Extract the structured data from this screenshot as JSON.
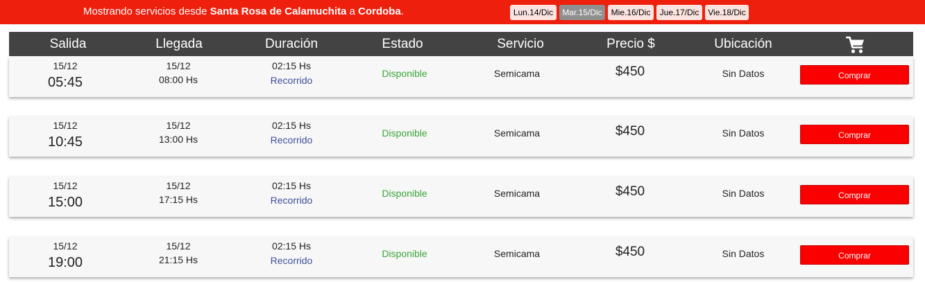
{
  "header": {
    "prefix": "Mostrando servicios desde",
    "origin": "Santa Rosa de Calamuchita",
    "connector": "a",
    "destination": "Cordoba",
    "suffix": ".",
    "days": [
      {
        "label": "Lun.14/Dic",
        "active": false
      },
      {
        "label": "Mar.15/Dic",
        "active": true
      },
      {
        "label": "Mie.16/Dic",
        "active": false
      },
      {
        "label": "Jue.17/Dic",
        "active": false
      },
      {
        "label": "Vie.18/Dic",
        "active": false
      }
    ]
  },
  "table": {
    "columns": [
      "Salida",
      "Llegada",
      "Duración",
      "Estado",
      "Servicio",
      "Precio $",
      "Ubicación"
    ],
    "cart_icon": "shopping-cart-icon",
    "rows": [
      {
        "salida_date": "15/12",
        "salida_time": "05:45",
        "llegada_date": "15/12",
        "llegada_time": "08:00 Hs",
        "duracion": "02:15 Hs",
        "recorrido": "Recorrido",
        "estado": "Disponible",
        "servicio": "Semicama",
        "precio": "$450",
        "ubicacion": "Sin Datos",
        "buy": "Comprar"
      },
      {
        "salida_date": "15/12",
        "salida_time": "10:45",
        "llegada_date": "15/12",
        "llegada_time": "13:00 Hs",
        "duracion": "02:15 Hs",
        "recorrido": "Recorrido",
        "estado": "Disponible",
        "servicio": "Semicama",
        "precio": "$450",
        "ubicacion": "Sin Datos",
        "buy": "Comprar"
      },
      {
        "salida_date": "15/12",
        "salida_time": "15:00",
        "llegada_date": "15/12",
        "llegada_time": "17:15 Hs",
        "duracion": "02:15 Hs",
        "recorrido": "Recorrido",
        "estado": "Disponible",
        "servicio": "Semicama",
        "precio": "$450",
        "ubicacion": "Sin Datos",
        "buy": "Comprar"
      },
      {
        "salida_date": "15/12",
        "salida_time": "19:00",
        "llegada_date": "15/12",
        "llegada_time": "21:15 Hs",
        "duracion": "02:15 Hs",
        "recorrido": "Recorrido",
        "estado": "Disponible",
        "servicio": "Semicama",
        "precio": "$450",
        "ubicacion": "Sin Datos",
        "buy": "Comprar"
      }
    ]
  },
  "colors": {
    "brand_red": "#ee1f0d",
    "header_dark": "#434343",
    "status_green": "#3aa53a",
    "link_blue": "#3d4f9a",
    "buy_red": "#fb0000"
  }
}
